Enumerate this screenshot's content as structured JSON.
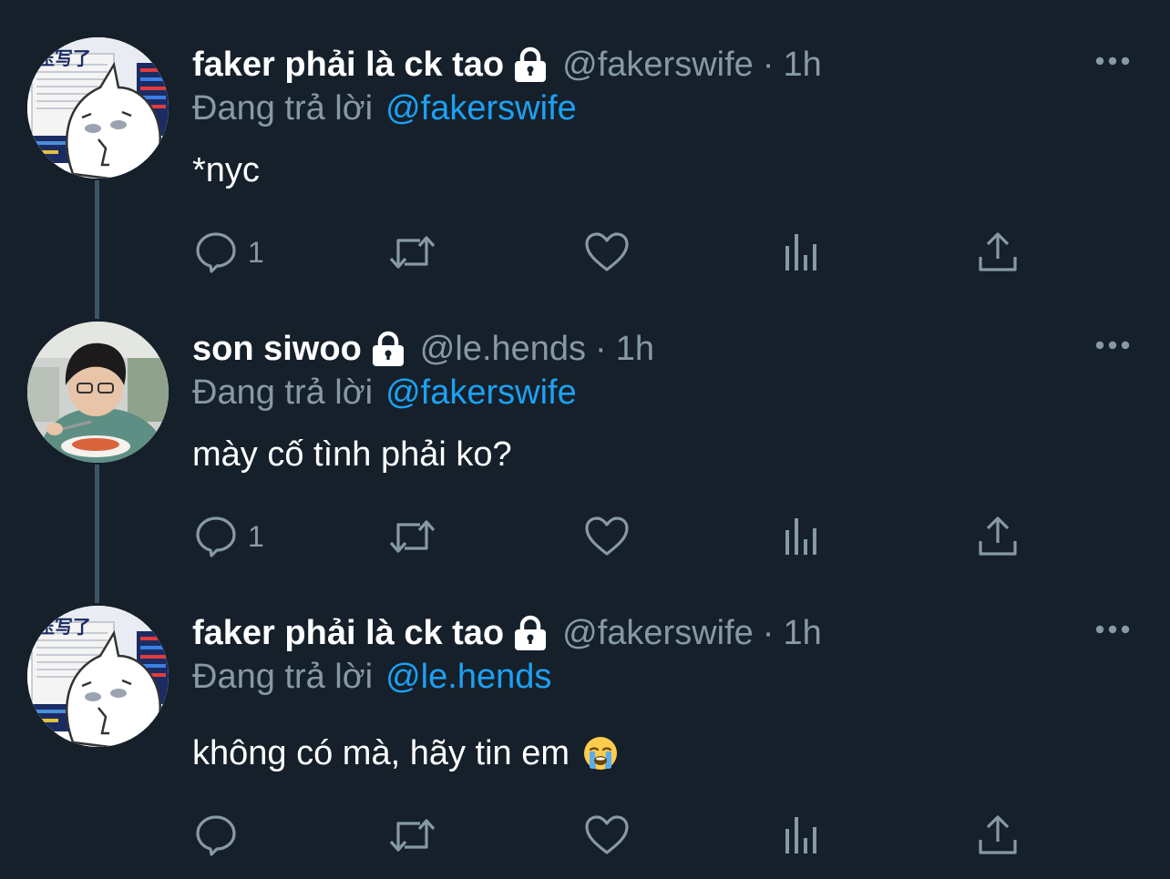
{
  "colors": {
    "background": "#15202b",
    "primary_text": "#ffffff",
    "secondary_text": "#8899a6",
    "link": "#1da1f2",
    "thread_line": "#3d5466"
  },
  "tweets": [
    {
      "avatar": "cartoon-drawing-avatar",
      "display_name": "faker phải là ck tao",
      "protected_icon": "lock-icon",
      "handle": "@fakerswife",
      "separator": "·",
      "time": "1h",
      "reply_prefix": "Đang trả lời",
      "reply_to": "@fakerswife",
      "text": "*nyc",
      "reply_count": "1"
    },
    {
      "avatar": "person-eating-avatar",
      "display_name": "son siwoo",
      "protected_icon": "lock-icon",
      "handle": "@le.hends",
      "separator": "·",
      "time": "1h",
      "reply_prefix": "Đang trả lời",
      "reply_to": "@fakerswife",
      "text": "mày cố tình phải ko?",
      "reply_count": "1"
    },
    {
      "avatar": "cartoon-drawing-avatar",
      "display_name": "faker phải là ck tao",
      "protected_icon": "lock-icon",
      "handle": "@fakerswife",
      "separator": "·",
      "time": "1h",
      "reply_prefix": "Đang trả lời",
      "reply_to": "@le.hends",
      "text": "không có mà, hãy tin em",
      "text_emoji": "loudly-crying-face-icon",
      "reply_count": ""
    }
  ],
  "action_icons": [
    "reply-icon",
    "retweet-icon",
    "like-icon",
    "analytics-icon",
    "share-icon"
  ],
  "more_icon": "more-options-icon"
}
